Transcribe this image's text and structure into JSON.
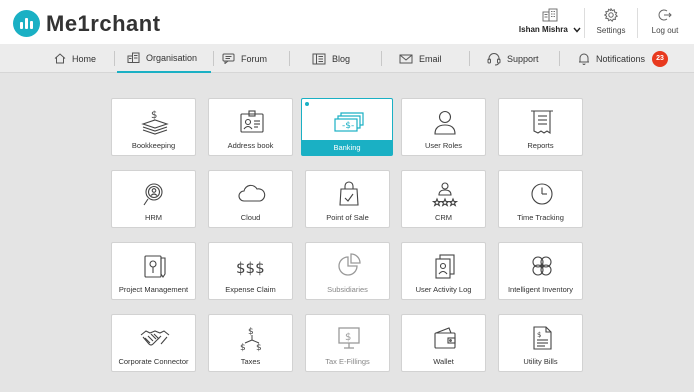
{
  "app": {
    "name": "Me1rchant"
  },
  "header": {
    "user_name": "Ishan Mishra",
    "settings_label": "Settings",
    "logout_label": "Log out"
  },
  "nav": {
    "items": [
      {
        "label": "Home",
        "icon": "home-icon"
      },
      {
        "label": "Organisation",
        "icon": "building-icon",
        "active": true
      },
      {
        "label": "Forum",
        "icon": "chat-icon"
      },
      {
        "label": "Blog",
        "icon": "blog-icon"
      },
      {
        "label": "Email",
        "icon": "envelope-icon"
      },
      {
        "label": "Support",
        "icon": "headset-icon"
      },
      {
        "label": "Notifications",
        "icon": "bell-icon",
        "badge": "23"
      }
    ]
  },
  "tiles": [
    {
      "label": "Bookkeeping",
      "icon": "money-stack-icon"
    },
    {
      "label": "Address book",
      "icon": "id-card-icon"
    },
    {
      "label": "Banking",
      "icon": "banknotes-icon",
      "active": true
    },
    {
      "label": "User Roles",
      "icon": "user-icon"
    },
    {
      "label": "Reports",
      "icon": "receipt-icon"
    },
    {
      "label": "HRM",
      "icon": "people-search-icon"
    },
    {
      "label": "Cloud",
      "icon": "cloud-icon"
    },
    {
      "label": "Point of Sale",
      "icon": "shopping-bag-icon"
    },
    {
      "label": "CRM",
      "icon": "customer-rating-icon"
    },
    {
      "label": "Time Tracking",
      "icon": "clock-icon"
    },
    {
      "label": "Project Management",
      "icon": "project-pencil-icon"
    },
    {
      "label": "Expense Claim",
      "icon": "dollar-signs-icon"
    },
    {
      "label": "Subsidiaries",
      "icon": "pie-chart-icon",
      "dim": true
    },
    {
      "label": "User Activity Log",
      "icon": "activity-log-icon"
    },
    {
      "label": "Intelligent Inventory",
      "icon": "clover-icon"
    },
    {
      "label": "Corporate Connector",
      "icon": "handshake-icon"
    },
    {
      "label": "Taxes",
      "icon": "tax-dollar-icon"
    },
    {
      "label": "Tax E-Fillings",
      "icon": "monitor-dollar-icon",
      "dim": true
    },
    {
      "label": "Wallet",
      "icon": "wallet-icon"
    },
    {
      "label": "Utility Bills",
      "icon": "bill-document-icon"
    }
  ],
  "colors": {
    "accent": "#1ab0c4",
    "badge": "#e8391e",
    "background": "#e4e4e4"
  }
}
